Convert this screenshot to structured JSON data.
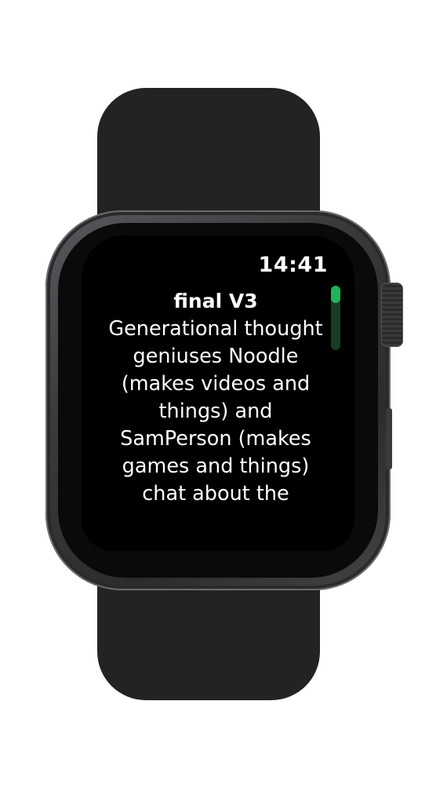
{
  "status_bar": {
    "time": "14:41"
  },
  "episode": {
    "title": "final V3",
    "description": "Generational thought geniuses Noodle (makes videos and things) and SamPerson (makes games and things) chat about the"
  },
  "scroll_indicator": {
    "position_fraction": 0.0,
    "visible_fraction": 0.27
  },
  "colors": {
    "screen_background": "#000000",
    "text": "#ffffff",
    "scroll_thumb": "#1fb45a",
    "scroll_track": "#173d25"
  }
}
